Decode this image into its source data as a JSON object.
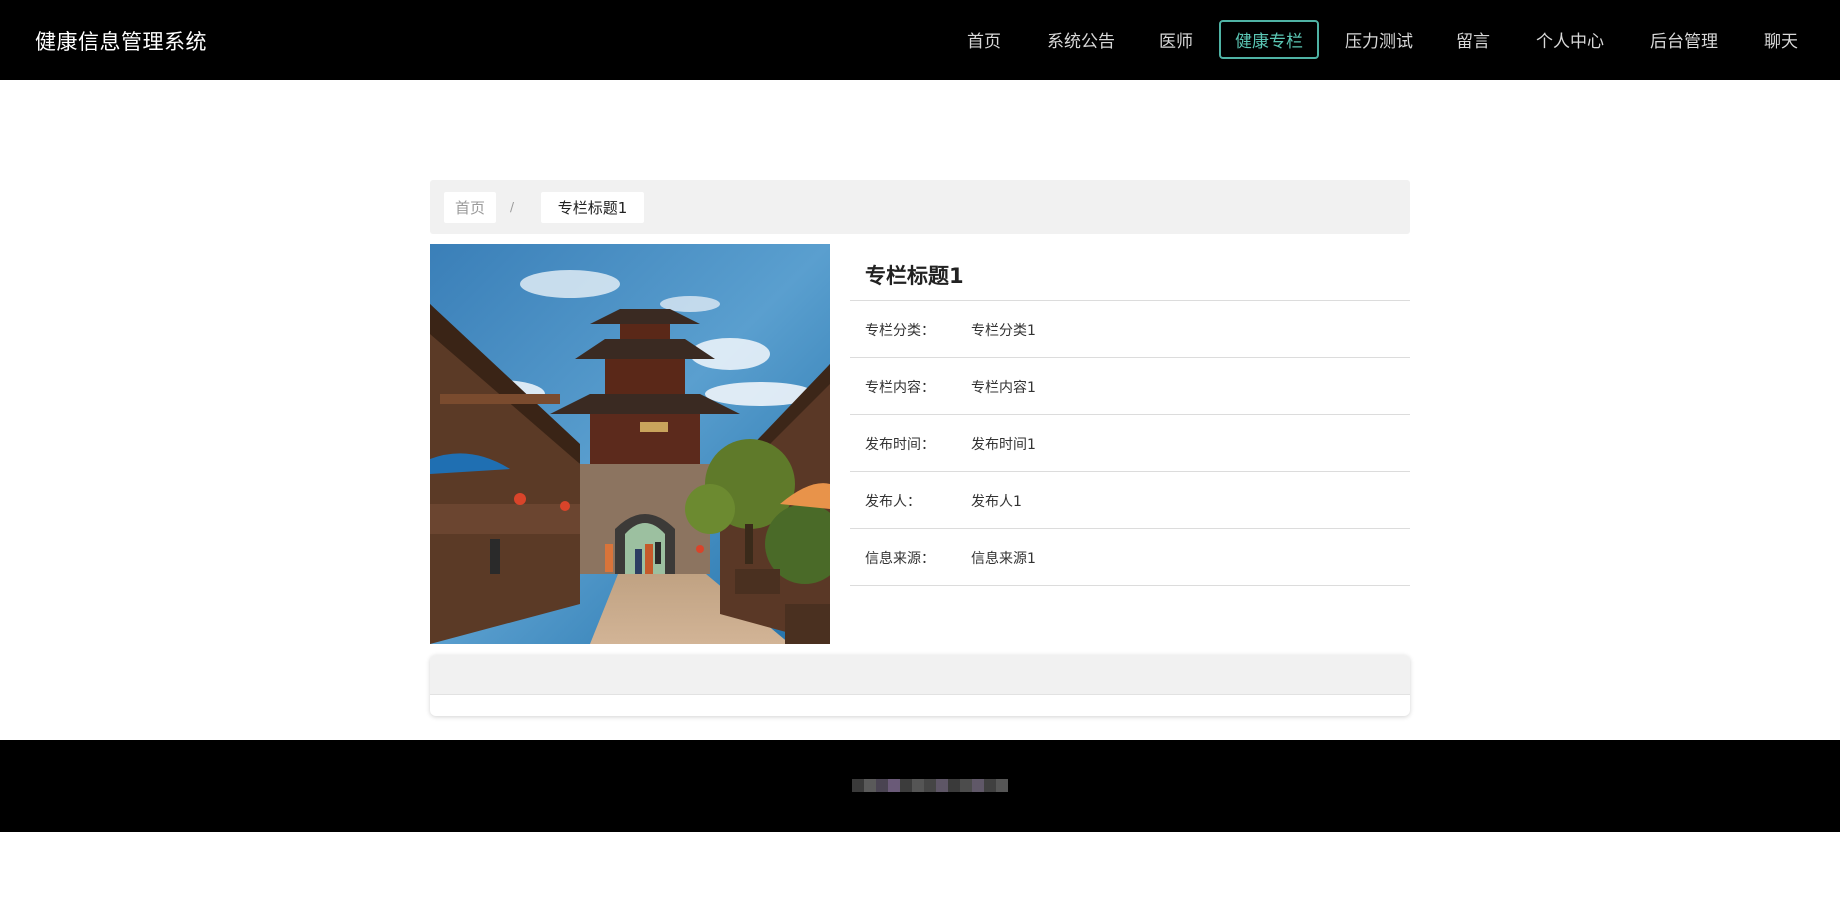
{
  "header": {
    "brand": "健康信息管理系统",
    "nav": [
      {
        "label": "首页",
        "active": false
      },
      {
        "label": "系统公告",
        "active": false
      },
      {
        "label": "医师",
        "active": false
      },
      {
        "label": "健康专栏",
        "active": true
      },
      {
        "label": "压力测试",
        "active": false
      },
      {
        "label": "留言",
        "active": false
      },
      {
        "label": "个人中心",
        "active": false
      },
      {
        "label": "后台管理",
        "active": false
      },
      {
        "label": "聊天",
        "active": false
      }
    ]
  },
  "breadcrumb": {
    "home": "首页",
    "separator": "/",
    "current": "专栏标题1"
  },
  "detail": {
    "title": "专栏标题1",
    "rows": [
      {
        "label": "专栏分类：",
        "value": "专栏分类1"
      },
      {
        "label": "专栏内容：",
        "value": "专栏内容1"
      },
      {
        "label": "发布时间：",
        "value": "发布时间1"
      },
      {
        "label": "发布人：",
        "value": "发布人1"
      },
      {
        "label": "信息来源：",
        "value": "信息来源1"
      }
    ]
  },
  "colors": {
    "header_bg": "#000000",
    "accent": "#5bc7b5",
    "panel_bg": "#f1f1f1"
  }
}
